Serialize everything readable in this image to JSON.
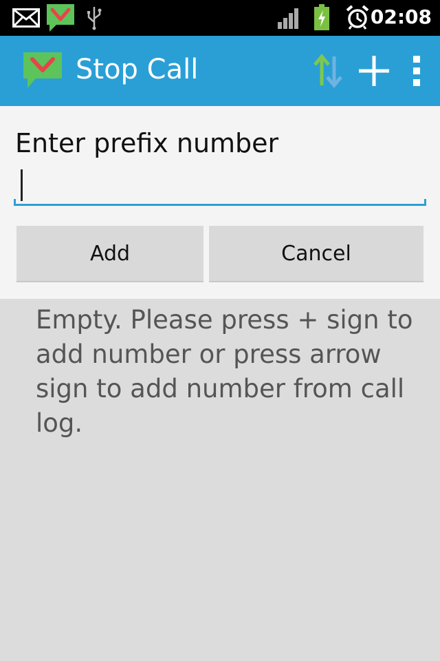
{
  "status_bar": {
    "time": "02:08",
    "icons": [
      "mail-icon",
      "stop-call-notification-icon",
      "usb-icon",
      "signal-icon",
      "battery-charging-icon",
      "alarm-icon"
    ]
  },
  "action_bar": {
    "title": "Stop Call",
    "actions": [
      "import-from-call-log-icon",
      "add-icon",
      "overflow-menu-icon"
    ]
  },
  "dialog": {
    "label": "Enter prefix number",
    "input_value": "",
    "add_label": "Add",
    "cancel_label": "Cancel"
  },
  "empty_message": "Empty. Please press + sign to add number or press arrow sign to add number from call log.",
  "colors": {
    "accent": "#2a9fd6",
    "status_bar": "#000000",
    "panel": "#f4f4f4",
    "background": "#dcdcdc",
    "button": "#d9d9d9",
    "app_icon_green": "#5cc45a",
    "app_icon_check": "#e8434a"
  }
}
